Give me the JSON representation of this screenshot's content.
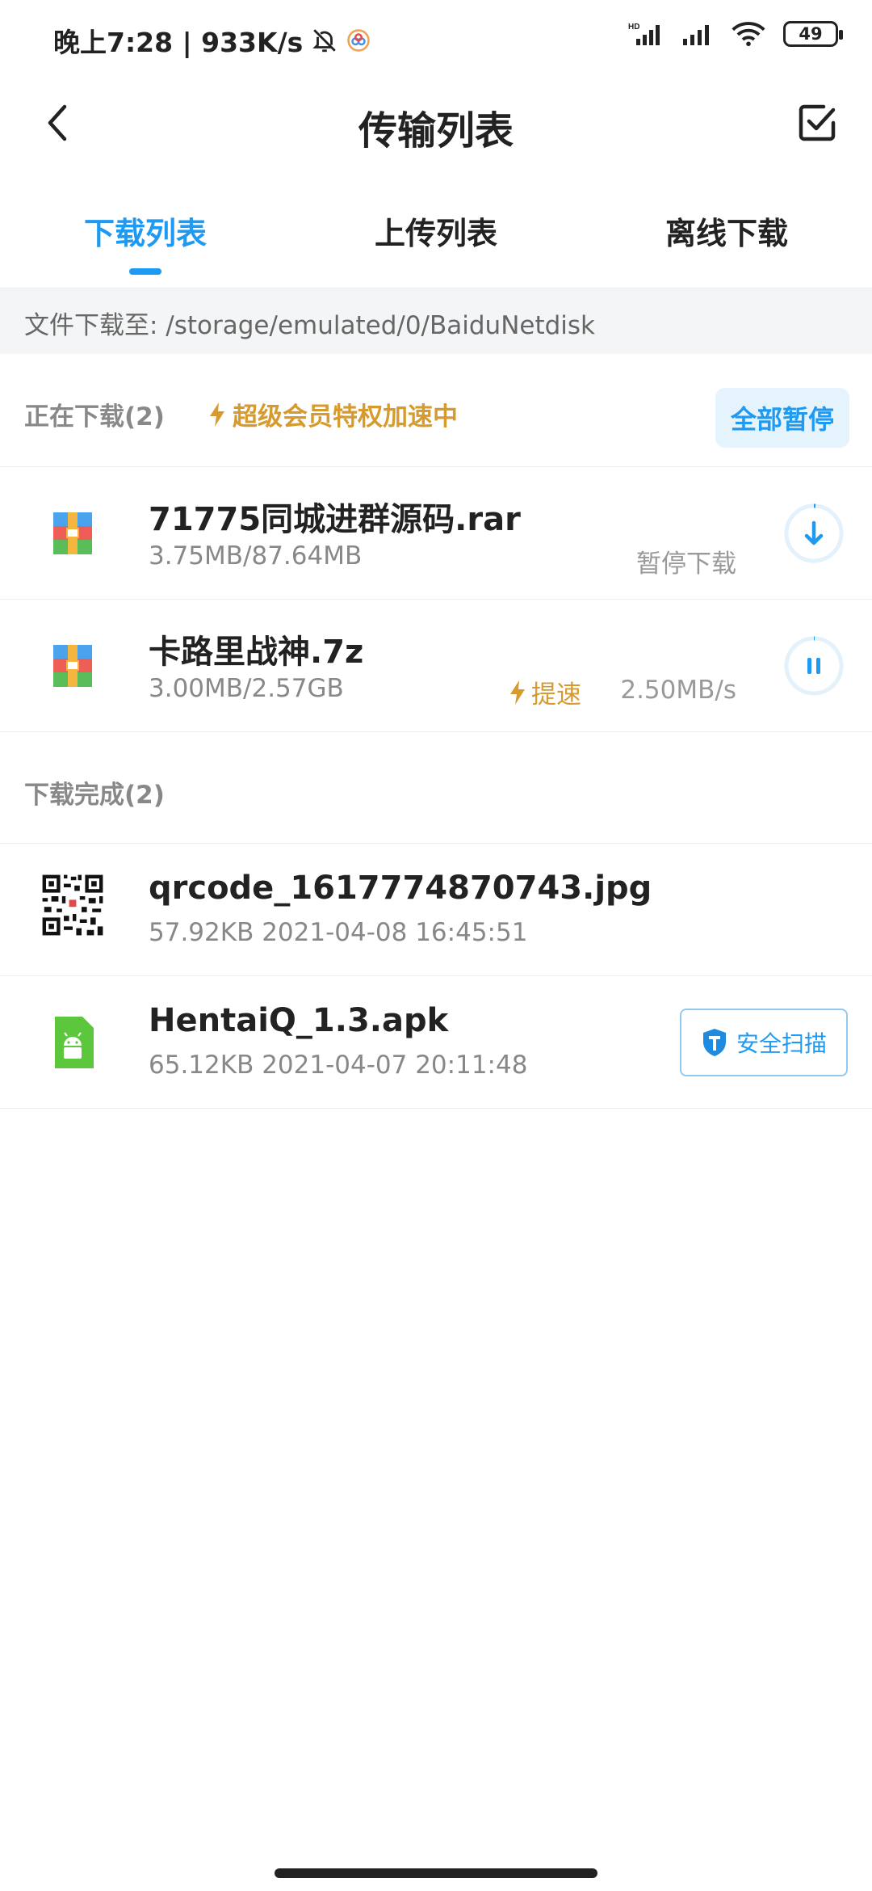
{
  "status_bar": {
    "time_speed": "晚上7:28 | 933K/s",
    "battery": "49"
  },
  "header": {
    "title": "传输列表"
  },
  "tabs": [
    {
      "label": "下载列表",
      "active": true
    },
    {
      "label": "上传列表",
      "active": false
    },
    {
      "label": "离线下载",
      "active": false
    }
  ],
  "path": {
    "text": "文件下载至: /storage/emulated/0/BaiduNetdisk"
  },
  "downloading": {
    "title": "正在下载(2)",
    "vip_label": "超级会员特权加速中",
    "pause_all_label": "全部暂停",
    "items": [
      {
        "name": "71775同城进群源码.rar",
        "meta": "3.75MB/87.64MB",
        "status": "暂停下载",
        "icon": "archive-icon",
        "action_icon": "download-arrow-icon"
      },
      {
        "name": "卡路里战神.7z",
        "meta": "3.00MB/2.57GB",
        "speedup": "提速",
        "speed": "2.50MB/s",
        "icon": "archive-icon",
        "action_icon": "pause-icon"
      }
    ]
  },
  "completed": {
    "title": "下载完成(2)",
    "items": [
      {
        "name": "qrcode_1617774870743.jpg",
        "meta": "57.92KB 2021-04-08 16:45:51",
        "icon": "qr-thumbnail"
      },
      {
        "name": "HentaiQ_1.3.apk",
        "meta": "65.12KB 2021-04-07 20:11:48",
        "icon": "android-apk-icon",
        "scan_label": "安全扫描"
      }
    ]
  },
  "colors": {
    "accent": "#1e9af2",
    "vip": "#d69a2d"
  }
}
